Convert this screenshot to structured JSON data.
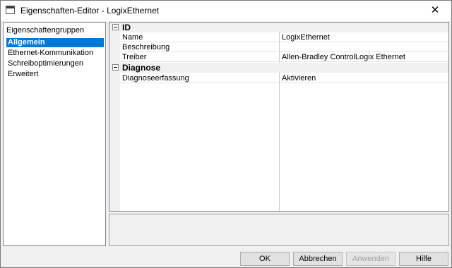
{
  "window": {
    "title": "Eigenschaften-Editor - LogixEthernet"
  },
  "groups": {
    "header": "Eigenschaftengruppen",
    "items": [
      {
        "label": "Allgemein",
        "selected": true
      },
      {
        "label": "Ethernet-Kommunikation",
        "selected": false
      },
      {
        "label": "Schreiboptimierungen",
        "selected": false
      },
      {
        "label": "Erweitert",
        "selected": false
      }
    ]
  },
  "grid": {
    "categories": [
      {
        "label": "ID",
        "rows": [
          {
            "name": "Name",
            "value": "LogixEthernet"
          },
          {
            "name": "Beschreibung",
            "value": ""
          },
          {
            "name": "Treiber",
            "value": "Allen-Bradley ControlLogix Ethernet"
          }
        ]
      },
      {
        "label": "Diagnose",
        "rows": [
          {
            "name": "Diagnoseerfassung",
            "value": "Aktivieren"
          }
        ]
      }
    ]
  },
  "buttons": {
    "ok": "OK",
    "cancel": "Abbrechen",
    "apply": "Anwenden",
    "help": "Hilfe"
  }
}
